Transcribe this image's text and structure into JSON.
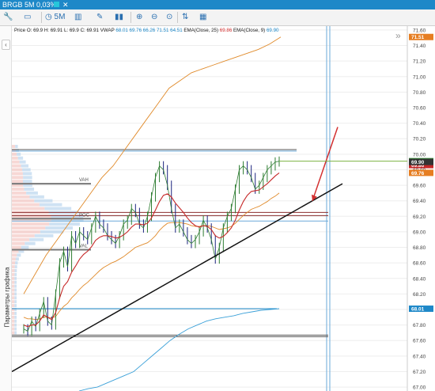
{
  "window": {
    "title": "BRGB 5M  0,03%",
    "close": "✕"
  },
  "toolbar": {
    "items": [
      {
        "name": "wrench-icon",
        "glyph": "🔧"
      },
      {
        "name": "folder-icon",
        "glyph": "▭"
      },
      {
        "name": "timeframe-button",
        "glyph": "◷ 5M"
      },
      {
        "name": "layout-icon",
        "glyph": "▥"
      },
      {
        "name": "draw-pen-icon",
        "glyph": "✎"
      },
      {
        "name": "indicators-icon",
        "glyph": "▮▮"
      },
      {
        "name": "zoom-in-icon",
        "glyph": "⊕"
      },
      {
        "name": "zoom-out-icon",
        "glyph": "⊖"
      },
      {
        "name": "search-icon",
        "glyph": "⊙"
      },
      {
        "name": "sort-icon",
        "glyph": "⇅"
      },
      {
        "name": "calendar-icon",
        "glyph": "▦"
      }
    ]
  },
  "legend": {
    "ohlc": "Price  O: 69.9  H: 69.91  L: 69.9  C: 69.91",
    "vwap_label": "VWAP",
    "vwap_values": "68.01  69.76  66.26  71.51  64.51",
    "ema25_label": "EMA(Close, 25)",
    "ema25_value": "69.86",
    "ema9_label": "EMA(Close, 9)",
    "ema9_value": "69.90"
  },
  "side_panel_label": "Параметры графика",
  "expand_glyph": "»",
  "collapse_glyph": "‹",
  "chart_data": {
    "type": "line",
    "instrument": "BRGB",
    "timeframe": "5M",
    "y_axis": {
      "ticks": [
        67.0,
        67.2,
        67.4,
        67.6,
        67.8,
        68.0,
        68.2,
        68.4,
        68.6,
        68.8,
        69.0,
        69.2,
        69.4,
        69.6,
        69.8,
        70.0,
        70.2,
        70.4,
        70.6,
        70.8,
        71.0,
        71.2,
        71.4,
        71.6
      ],
      "ylim": [
        66.95,
        71.65
      ]
    },
    "price_badges": [
      {
        "label": "71.51",
        "value": 71.51,
        "color": "#e67e22"
      },
      {
        "label": "69.91",
        "value": 69.91,
        "color": "#2e7d32"
      },
      {
        "label": "69.86",
        "value": 69.86,
        "color": "#c62828"
      },
      {
        "label": "69.90",
        "value": 69.9,
        "color": "#333333"
      },
      {
        "label": "69.76",
        "value": 69.76,
        "color": "#e67e22"
      },
      {
        "label": "68.01",
        "value": 68.01,
        "color": "#1e88c8"
      }
    ],
    "volume_profile_labels": [
      {
        "text": "VAH",
        "value": 69.62
      },
      {
        "text": "POC",
        "value": 69.17
      },
      {
        "text": "VAL",
        "value": 68.77
      }
    ],
    "horizontal_levels": [
      70.06,
      70.04,
      69.25,
      69.21,
      69.14,
      68.01,
      67.67,
      67.65
    ],
    "price_series": [
      67.75,
      67.72,
      67.85,
      67.78,
      67.95,
      68.1,
      67.85,
      67.8,
      68.2,
      68.6,
      68.75,
      68.55,
      68.95,
      68.85,
      69.0,
      68.95,
      68.9,
      69.05,
      69.2,
      69.1,
      69.05,
      68.95,
      68.9,
      68.85,
      68.95,
      69.1,
      69.15,
      69.3,
      69.25,
      69.1,
      69.05,
      69.2,
      69.45,
      69.7,
      69.85,
      69.8,
      69.6,
      69.3,
      69.05,
      69.1,
      69.0,
      68.9,
      68.85,
      68.9,
      69.0,
      69.15,
      69.05,
      68.9,
      68.65,
      68.8,
      69.05,
      69.2,
      69.3,
      69.55,
      69.8,
      69.85,
      69.8,
      69.7,
      69.55,
      69.6,
      69.7,
      69.8,
      69.85,
      69.9,
      69.91
    ],
    "ema9_series": [
      67.8,
      67.78,
      67.8,
      67.8,
      67.85,
      67.93,
      67.9,
      67.87,
      67.96,
      68.15,
      68.3,
      68.36,
      68.48,
      68.56,
      68.65,
      68.71,
      68.75,
      68.81,
      68.89,
      68.93,
      68.95,
      68.95,
      68.94,
      68.92,
      68.93,
      68.96,
      69.0,
      69.06,
      69.1,
      69.1,
      69.09,
      69.11,
      69.18,
      69.28,
      69.39,
      69.47,
      69.49,
      69.45,
      69.37,
      69.31,
      69.25,
      69.18,
      69.12,
      69.08,
      69.06,
      69.08,
      69.07,
      69.03,
      68.95,
      68.92,
      68.94,
      68.99,
      69.05,
      69.15,
      69.28,
      69.39,
      69.47,
      69.52,
      69.53,
      69.54,
      69.58,
      69.62,
      69.67,
      69.72,
      69.76
    ],
    "ema25_series": [
      67.9,
      67.88,
      67.88,
      67.87,
      67.88,
      67.9,
      67.9,
      67.89,
      67.91,
      67.98,
      68.04,
      68.08,
      68.15,
      68.2,
      68.26,
      68.31,
      68.35,
      68.4,
      68.45,
      68.5,
      68.54,
      68.57,
      68.6,
      68.62,
      68.65,
      68.68,
      68.72,
      68.76,
      68.8,
      68.82,
      68.84,
      68.86,
      68.9,
      68.95,
      69.02,
      69.07,
      69.11,
      69.12,
      69.12,
      69.12,
      69.11,
      69.1,
      69.08,
      69.07,
      69.07,
      69.08,
      69.08,
      69.07,
      69.05,
      69.03,
      69.04,
      69.05,
      69.07,
      69.11,
      69.16,
      69.21,
      69.25,
      69.29,
      69.31,
      69.33,
      69.36,
      69.39,
      69.43,
      69.46,
      69.5
    ],
    "vwap_upper_series": [
      68.2,
      68.45,
      68.7,
      68.9,
      69.1,
      69.3,
      69.5,
      69.7,
      69.85,
      70.05,
      70.25,
      70.45,
      70.65,
      70.85,
      70.95,
      71.05,
      71.1,
      71.15,
      71.2,
      71.25,
      71.3,
      71.35,
      71.42,
      71.51
    ],
    "vwap_lower_series": [
      66.95,
      66.98,
      67.0,
      67.05,
      67.1,
      67.15,
      67.2,
      67.3,
      67.4,
      67.5,
      67.6,
      67.68,
      67.75,
      67.8,
      67.85,
      67.88,
      67.9,
      67.92,
      67.95,
      67.97,
      67.99,
      68.0,
      68.01
    ],
    "trendline": {
      "from": 67.2,
      "to": 69.62
    },
    "annotation_arrow": {
      "from": 70.35,
      "to": 69.4
    }
  }
}
